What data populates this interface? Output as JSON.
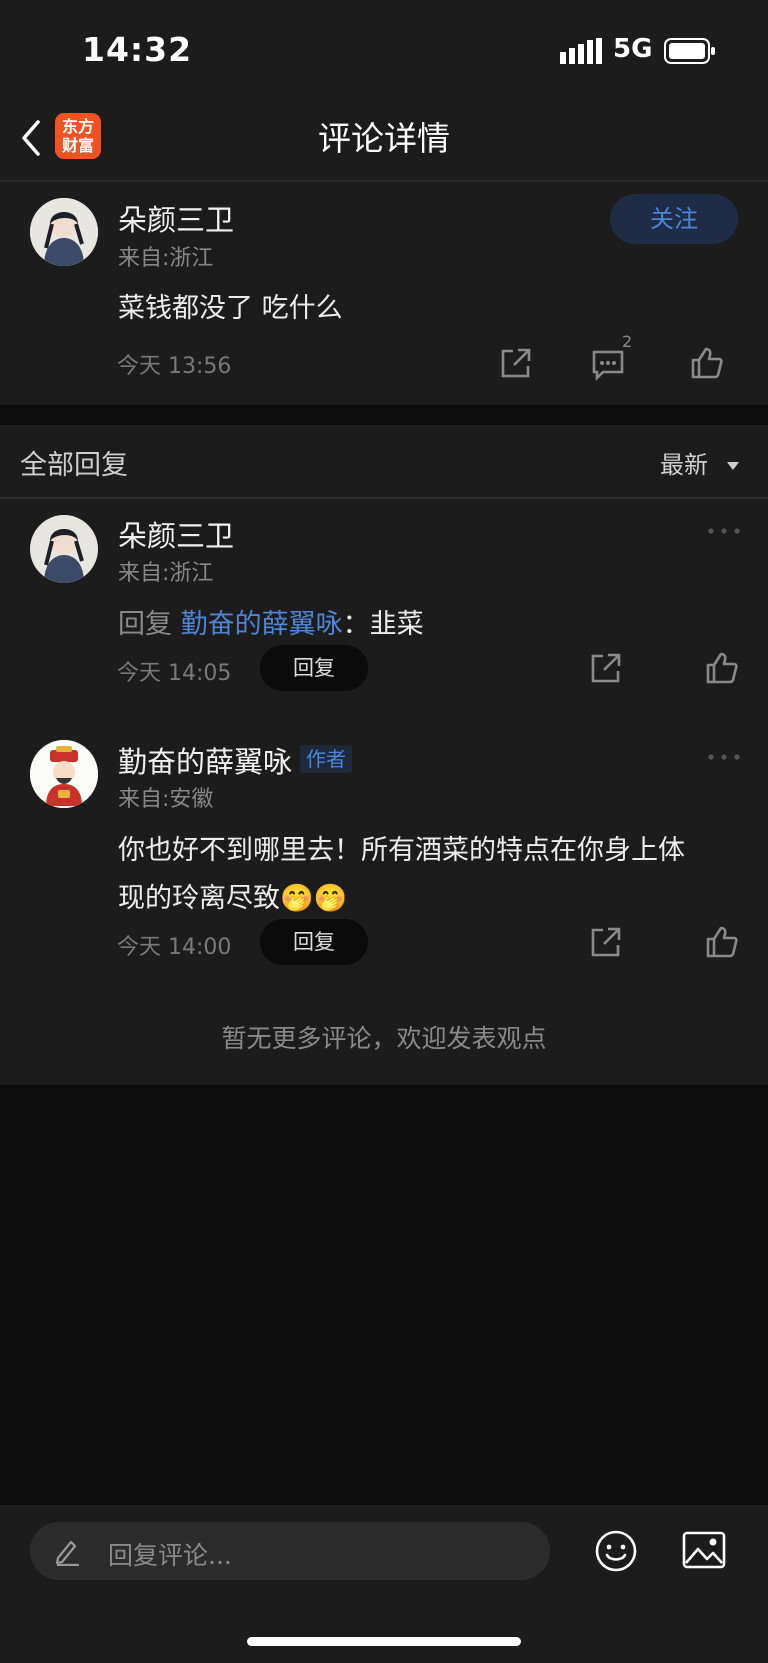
{
  "status_bar": {
    "time": "14:32",
    "network": "5G"
  },
  "nav": {
    "title": "评论详情",
    "logo_line1": "东方",
    "logo_line2": "财富"
  },
  "main_comment": {
    "user": "朵颜三卫",
    "from": "来自:浙江",
    "content": "菜钱都没了 吃什么",
    "time": "今天 13:56",
    "follow_label": "关注",
    "reply_count": "2"
  },
  "replies_section": {
    "title": "全部回复",
    "sort_label": "最新",
    "items": [
      {
        "user": "朵颜三卫",
        "from": "来自:浙江",
        "reply_prefix": "回复",
        "reply_to": "勤奋的薛翼咏",
        "sep": "：",
        "content": "韭菜",
        "time": "今天 14:05",
        "reply_label": "回复"
      },
      {
        "user": "勤奋的薛翼咏",
        "author_tag": "作者",
        "from": "来自:安徽",
        "content_line1": "你也好不到哪里去！所有酒菜的特点在你身上体",
        "content_line2": "现的玲离尽致",
        "emoji": "🤭🤭",
        "time": "今天 14:00",
        "reply_label": "回复"
      }
    ],
    "no_more": "暂无更多评论，欢迎发表观点"
  },
  "bottom_bar": {
    "placeholder": "回复评论..."
  },
  "colors": {
    "accent": "#4b86d8",
    "brand": "#f05322",
    "background": "#1c1c1c"
  }
}
